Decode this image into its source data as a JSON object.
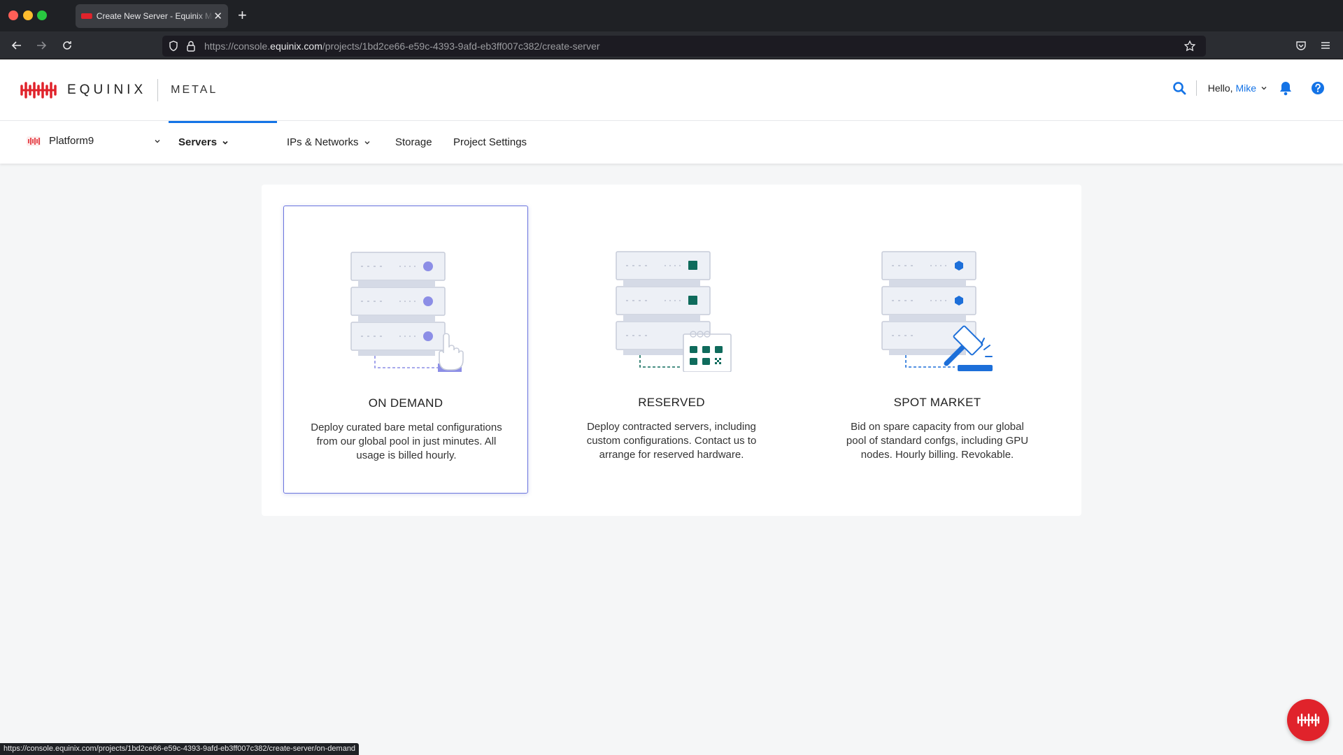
{
  "browser": {
    "tab_title": "Create New Server - Equinix Metal",
    "url_prefix": "https://console.",
    "url_host": "equinix.com",
    "url_path": "/projects/1bd2ce66-e59c-4393-9afd-eb3ff007c382/create-server",
    "status_url": "https://console.equinix.com/projects/1bd2ce66-e59c-4393-9afd-eb3ff007c382/create-server/on-demand"
  },
  "header": {
    "logo_text": "EQUINIX",
    "product_text": "METAL",
    "greeting": "Hello,",
    "user_name": "Mike"
  },
  "subnav": {
    "project_name": "Platform9",
    "items": [
      {
        "label": "Servers"
      },
      {
        "label": "IPs & Networks"
      },
      {
        "label": "Storage"
      },
      {
        "label": "Project Settings"
      }
    ]
  },
  "options": [
    {
      "title": "ON DEMAND",
      "description": "Deploy curated bare metal configurations from our global pool in just minutes. All usage is billed hourly."
    },
    {
      "title": "RESERVED",
      "description": "Deploy contracted servers, including custom configurations. Contact us to arrange for reserved hardware."
    },
    {
      "title": "SPOT MARKET",
      "description": "Bid on spare capacity from our global pool of standard confgs, including GPU nodes. Hourly billing. Revokable."
    }
  ],
  "colors": {
    "brand_red": "#e0232b",
    "accent_blue": "#1473e6",
    "on_demand": "#8c8ee6",
    "reserved": "#0f6b5c",
    "spot": "#1d6fd9"
  }
}
